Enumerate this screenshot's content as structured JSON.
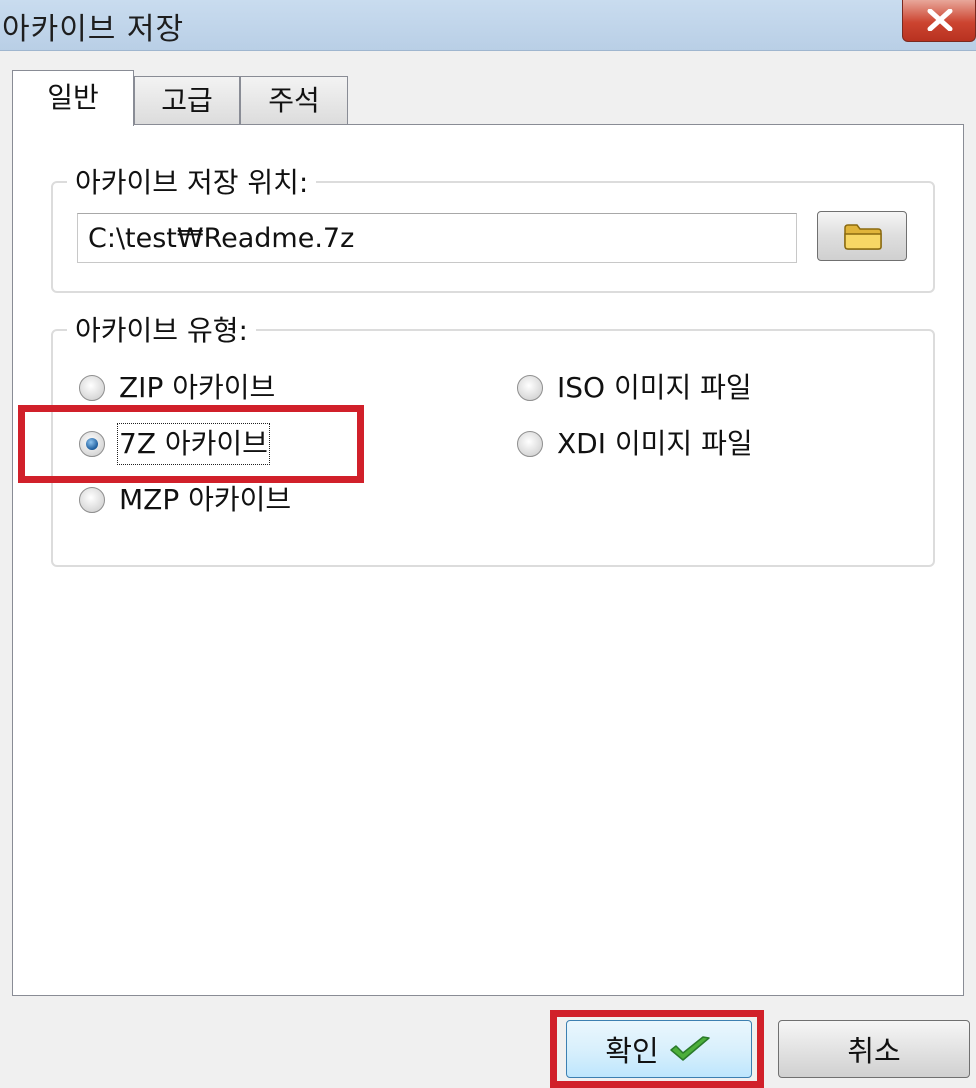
{
  "window": {
    "title": "아카이브 저장"
  },
  "tabs": [
    {
      "label": "일반",
      "active": true
    },
    {
      "label": "고급",
      "active": false
    },
    {
      "label": "주석",
      "active": false
    }
  ],
  "location": {
    "label": "아카이브 저장 위치:",
    "path": "C:\\test₩Readme.7z",
    "browse_icon": "folder-icon"
  },
  "archive_type": {
    "label": "아카이브 유형:",
    "options": [
      {
        "label": "ZIP 아카이브",
        "checked": false
      },
      {
        "label": "7Z 아카이브",
        "checked": true
      },
      {
        "label": "MZP 아카이브",
        "checked": false
      },
      {
        "label": "ISO 이미지 파일",
        "checked": false
      },
      {
        "label": "XDI 이미지 파일",
        "checked": false
      }
    ]
  },
  "buttons": {
    "ok": "확인",
    "cancel": "취소"
  },
  "colors": {
    "highlight": "#d1202a",
    "checkmark": "#3a9a3a",
    "folder": "#f2c94c"
  }
}
